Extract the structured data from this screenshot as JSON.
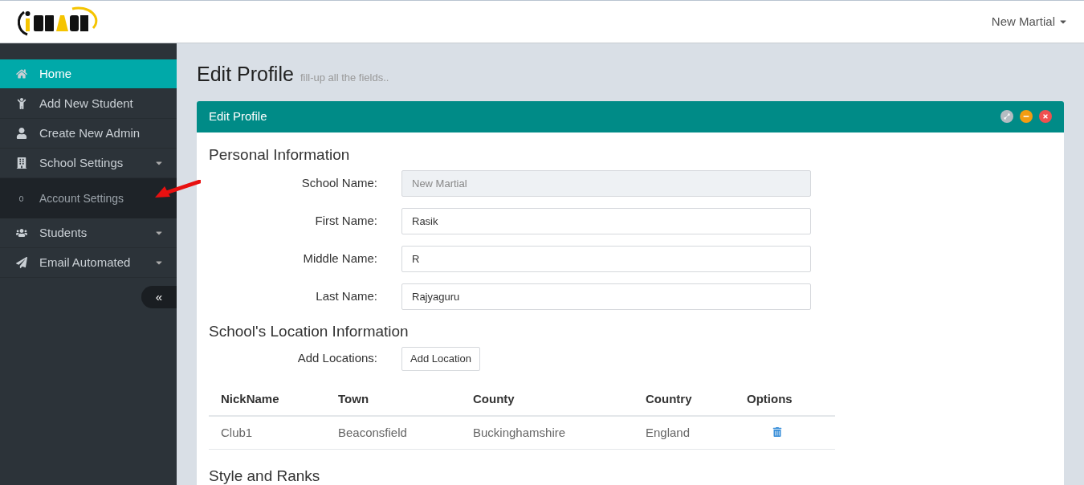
{
  "header": {
    "user_menu": "New Martial"
  },
  "sidebar": {
    "items": [
      {
        "label": "Home",
        "selected": true,
        "expandable": false
      },
      {
        "label": "Add New Student",
        "selected": false,
        "expandable": false
      },
      {
        "label": "Create New Admin",
        "selected": false,
        "expandable": false
      },
      {
        "label": "School Settings",
        "selected": false,
        "expandable": true,
        "children": [
          {
            "label": "Account Settings",
            "selected": false
          }
        ]
      },
      {
        "label": "Students",
        "selected": false,
        "expandable": true
      },
      {
        "label": "Email Automated",
        "selected": false,
        "expandable": true
      }
    ],
    "collapse_button": "«"
  },
  "page": {
    "title": "Edit Profile",
    "subtitle": "fill-up all the fields.."
  },
  "panel": {
    "title": "Edit Profile",
    "sections": [
      {
        "heading": "Personal Information",
        "fields": [
          {
            "label": "School Name:",
            "value": "New Martial",
            "disabled": true
          },
          {
            "label": "First Name:",
            "value": "Rasik",
            "disabled": false
          },
          {
            "label": "Middle Name:",
            "value": "R",
            "disabled": false
          },
          {
            "label": "Last Name:",
            "value": "Rajyaguru",
            "disabled": false
          }
        ]
      },
      {
        "heading": "School's Location Information",
        "add_label": "Add Locations:",
        "add_button": "Add Location",
        "table": {
          "columns": [
            "NickName",
            "Town",
            "County",
            "Country",
            "Options"
          ],
          "rows": [
            [
              "Club1",
              "Beaconsfield",
              "Buckinghamshire",
              "England"
            ]
          ]
        }
      },
      {
        "heading": "Style and Ranks"
      }
    ]
  }
}
